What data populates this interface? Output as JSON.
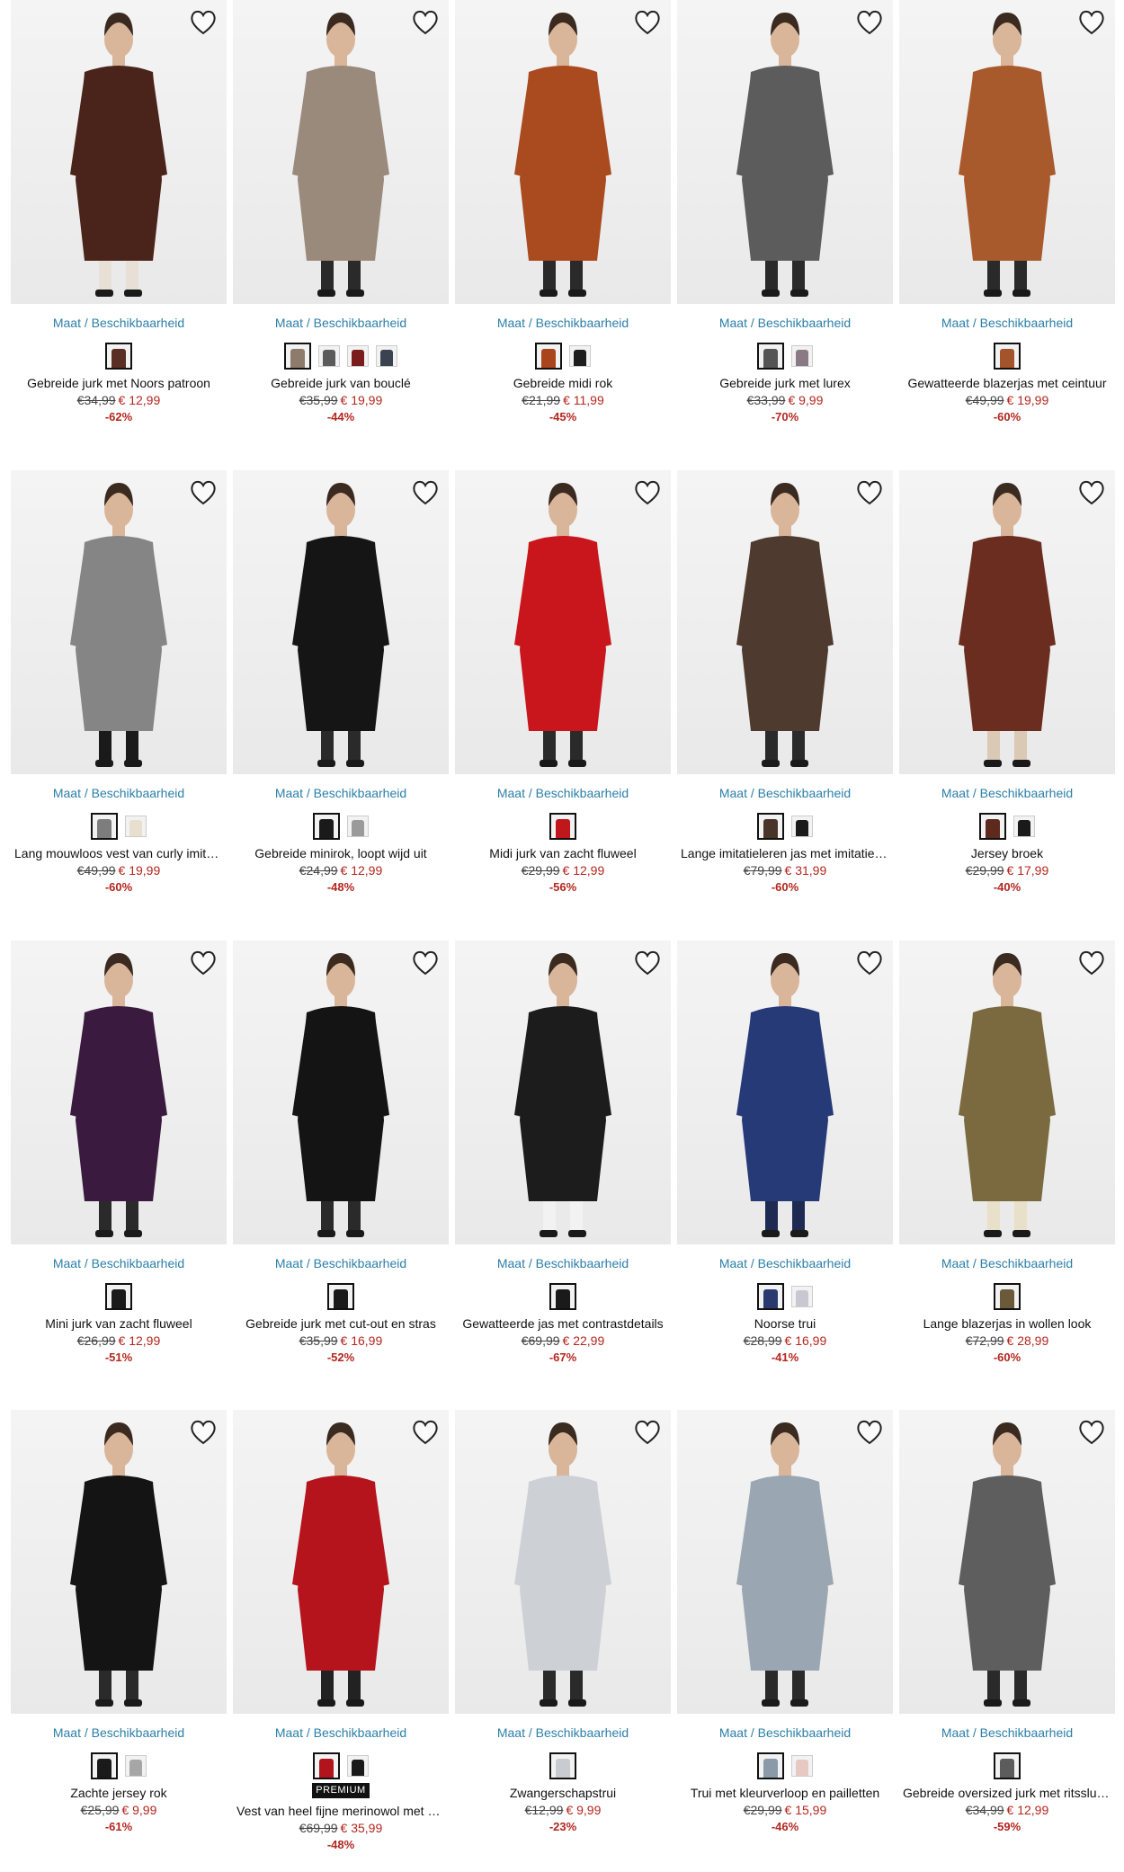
{
  "colors": {
    "accent_link": "#2c7fa8",
    "sale_red": "#b3261e",
    "text": "#111111"
  },
  "availability_label": "Maat / Beschikbaarheid",
  "products": [
    {
      "title": "Gebreide jurk met Noors patroon",
      "old_price": "€34,99",
      "new_price": "€ 12,99",
      "discount": "-62%",
      "badge": "",
      "swatches": [
        "#5a2e22"
      ],
      "garment": "#4a231a",
      "accent": "#e8e0d6"
    },
    {
      "title": "Gebreide jurk van bouclé",
      "old_price": "€35,99",
      "new_price": "€ 19,99",
      "discount": "-44%",
      "badge": "",
      "swatches": [
        "#8d7b6c",
        "#5b5b5b",
        "#7a1c1c",
        "#3b4350"
      ],
      "garment": "#9a8a7c",
      "accent": ""
    },
    {
      "title": "Gebreide midi rok",
      "old_price": "€21,99",
      "new_price": "€ 11,99",
      "discount": "-45%",
      "badge": "",
      "swatches": [
        "#a9441d",
        "#1d1d1d"
      ],
      "garment": "#a94a1f",
      "accent": ""
    },
    {
      "title": "Gebreide jurk met lurex",
      "old_price": "€33,99",
      "new_price": "€ 9,99",
      "discount": "-70%",
      "badge": "",
      "swatches": [
        "#555555",
        "#8a7a86"
      ],
      "garment": "#5c5c5c",
      "accent": ""
    },
    {
      "title": "Gewatteerde blazerjas met ceintuur",
      "old_price": "€49,99",
      "new_price": "€ 19,99",
      "discount": "-60%",
      "badge": "",
      "swatches": [
        "#a4542a"
      ],
      "garment": "#a95a2d",
      "accent": ""
    },
    {
      "title": "Lang mouwloos vest van curly imitatiebont",
      "old_price": "€49,99",
      "new_price": "€ 19,99",
      "discount": "-60%",
      "badge": "",
      "swatches": [
        "#7d7d7d",
        "#e8e0cf"
      ],
      "garment": "#858585",
      "accent": "#1a1a1a"
    },
    {
      "title": "Gebreide minirok, loopt wijd uit",
      "old_price": "€24,99",
      "new_price": "€ 12,99",
      "discount": "-48%",
      "badge": "",
      "swatches": [
        "#1a1a1a",
        "#9a9a9a"
      ],
      "garment": "#151515",
      "accent": ""
    },
    {
      "title": "Midi jurk van zacht fluweel",
      "old_price": "€29,99",
      "new_price": "€ 12,99",
      "discount": "-56%",
      "badge": "",
      "swatches": [
        "#c0171d"
      ],
      "garment": "#c8161c",
      "accent": ""
    },
    {
      "title": "Lange imitatieleren jas met imitatiebont",
      "old_price": "€79,99",
      "new_price": "€ 31,99",
      "discount": "-60%",
      "badge": "",
      "swatches": [
        "#4a3429",
        "#1a1a1a"
      ],
      "garment": "#4e3a2e",
      "accent": ""
    },
    {
      "title": "Jersey broek",
      "old_price": "€29,99",
      "new_price": "€ 17,99",
      "discount": "-40%",
      "badge": "",
      "swatches": [
        "#5e2a1e",
        "#1a1a1a"
      ],
      "garment": "#6b2d20",
      "accent": "#d9c9b5"
    },
    {
      "title": "Mini jurk van zacht fluweel",
      "old_price": "€26,99",
      "new_price": "€ 12,99",
      "discount": "-51%",
      "badge": "",
      "swatches": [
        "#1a1a1a"
      ],
      "garment": "#3b1a3f",
      "accent": ""
    },
    {
      "title": "Gebreide jurk met cut-out en stras",
      "old_price": "€35,99",
      "new_price": "€ 16,99",
      "discount": "-52%",
      "badge": "",
      "swatches": [
        "#1a1a1a"
      ],
      "garment": "#141414",
      "accent": ""
    },
    {
      "title": "Gewatteerde jas met contrastdetails",
      "old_price": "€69,99",
      "new_price": "€ 22,99",
      "discount": "-67%",
      "badge": "",
      "swatches": [
        "#1a1a1a"
      ],
      "garment": "#1c1c1c",
      "accent": "#f2f2f2"
    },
    {
      "title": "Noorse trui",
      "old_price": "€28,99",
      "new_price": "€ 16,99",
      "discount": "-41%",
      "badge": "",
      "swatches": [
        "#2a3a6e",
        "#c8c8d2"
      ],
      "garment": "#263a78",
      "accent": "#1e2a52"
    },
    {
      "title": "Lange blazerjas in wollen look",
      "old_price": "€72,99",
      "new_price": "€ 28,99",
      "discount": "-60%",
      "badge": "",
      "swatches": [
        "#6b5a3a"
      ],
      "garment": "#7b6a40",
      "accent": "#e9e0c9"
    },
    {
      "title": "Zachte jersey rok",
      "old_price": "€25,99",
      "new_price": "€ 9,99",
      "discount": "-61%",
      "badge": "",
      "swatches": [
        "#1a1a1a",
        "#a6a6a6"
      ],
      "garment": "#141414",
      "accent": ""
    },
    {
      "title": "Vest van heel fijne merinowol met sjaal",
      "old_price": "€69,99",
      "new_price": "€ 35,99",
      "discount": "-48%",
      "badge": "PREMIUM",
      "swatches": [
        "#b3141c",
        "#1a1a1a"
      ],
      "garment": "#b5141c",
      "accent": "#222222"
    },
    {
      "title": "Zwangerschapstrui",
      "old_price": "€12,99",
      "new_price": "€ 9,99",
      "discount": "-23%",
      "badge": "",
      "swatches": [
        "#c8cbd0"
      ],
      "garment": "#cdd0d5",
      "accent": "#2a2a2a"
    },
    {
      "title": "Trui met kleurverloop en pailletten",
      "old_price": "€29,99",
      "new_price": "€ 15,99",
      "discount": "-46%",
      "badge": "",
      "swatches": [
        "#8a9aa8",
        "#e7c8c2"
      ],
      "garment": "#9aa7b2",
      "accent": "#2a2a2a"
    },
    {
      "title": "Gebreide oversized jurk met ritssluiting",
      "old_price": "€34,99",
      "new_price": "€ 12,99",
      "discount": "-59%",
      "badge": "",
      "swatches": [
        "#5c5c5c"
      ],
      "garment": "#5e5e5e",
      "accent": ""
    }
  ]
}
